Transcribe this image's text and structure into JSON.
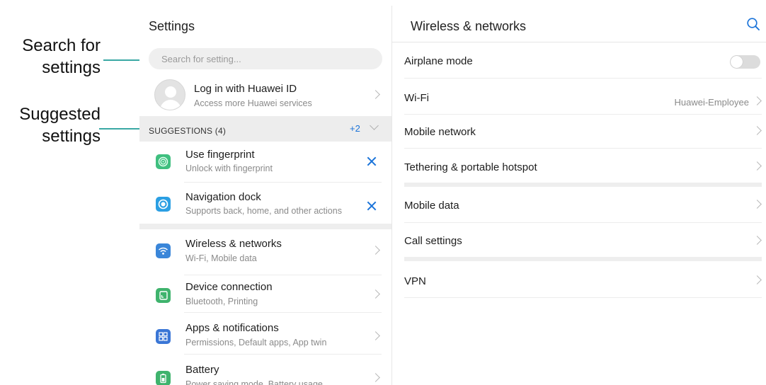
{
  "callouts": {
    "search": "Search for\nsettings",
    "suggested": "Suggested\nsettings",
    "leader_color": "#3aa8a4"
  },
  "left": {
    "title": "Settings",
    "search_placeholder": "Search for setting...",
    "account": {
      "title": "Log in with Huawei ID",
      "subtitle": "Access more Huawei services"
    },
    "suggestions": {
      "label": "SUGGESTIONS (4)",
      "more": "+2",
      "items": [
        {
          "title": "Use fingerprint",
          "subtitle": "Unlock with fingerprint",
          "icon": "fingerprint-icon",
          "color": "#3fbf7f"
        },
        {
          "title": "Navigation dock",
          "subtitle": "Supports back, home, and other actions",
          "icon": "navigation-dock-icon",
          "color": "#2b9fe3"
        }
      ]
    },
    "items": [
      {
        "title": "Wireless & networks",
        "subtitle": "Wi-Fi, Mobile data",
        "icon": "wifi-icon",
        "color": "#3a86d9"
      },
      {
        "title": "Device connection",
        "subtitle": "Bluetooth, Printing",
        "icon": "device-connection-icon",
        "color": "#3fb36d"
      },
      {
        "title": "Apps & notifications",
        "subtitle": "Permissions, Default apps, App twin",
        "icon": "apps-icon",
        "color": "#3a76d6"
      },
      {
        "title": "Battery",
        "subtitle": "Power saving mode, Battery usage",
        "icon": "battery-icon",
        "color": "#3fb36d"
      }
    ]
  },
  "right": {
    "title": "Wireless & networks",
    "airplane_mode": {
      "label": "Airplane mode",
      "enabled": false
    },
    "wifi": {
      "label": "Wi-Fi",
      "value": "Huawei-Employee"
    },
    "mobile_network": "Mobile network",
    "tethering": "Tethering & portable hotspot",
    "mobile_data": "Mobile data",
    "call_settings": "Call settings",
    "vpn": "VPN"
  },
  "colors": {
    "accent": "#1a73d9",
    "divider": "#ececec"
  }
}
